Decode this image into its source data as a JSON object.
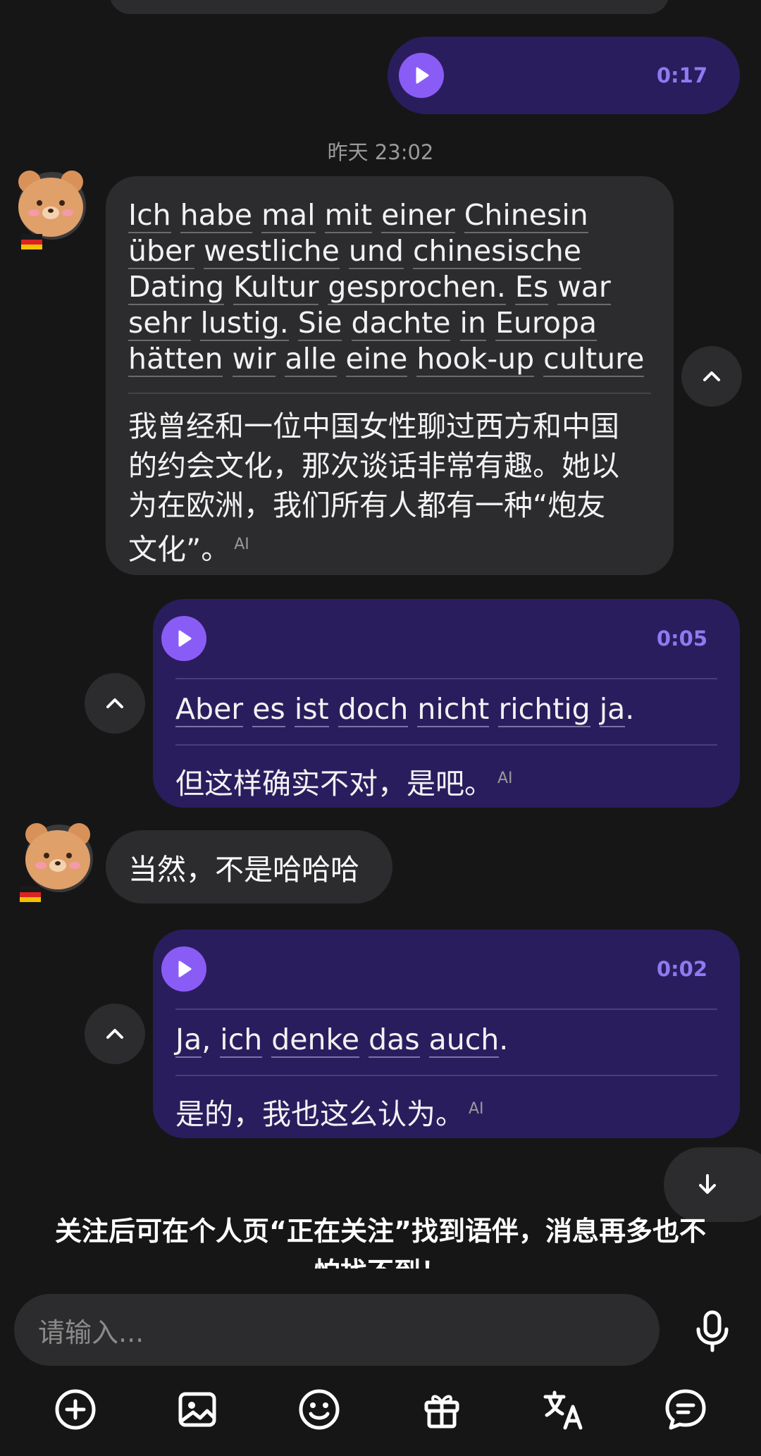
{
  "messages": {
    "voice_top": {
      "duration": "0:17"
    },
    "timestamp": "昨天 23:02",
    "msg1": {
      "de_words": [
        "Ich",
        "habe",
        "mal",
        "mit",
        "einer",
        "Chinesin",
        "über",
        "westliche",
        "und",
        "chinesische",
        "Dating",
        "Kultur",
        "gesprochen.",
        "Es",
        "war",
        "sehr",
        "lustig.",
        "Sie",
        "dachte",
        "in",
        "Europa",
        "hätten",
        "wir",
        "alle",
        "eine",
        "hook-up",
        "culture"
      ],
      "de_lines": [
        "Ich habe mal mit einer Chinesin",
        "über westliche und chinesische",
        "Dating Kultur gesprochen. Es war",
        "sehr lustig. Sie dachte in Europa",
        "hätten wir alle eine hook-up culture"
      ],
      "zh_lines": [
        "我曾经和一位中国女性聊过西方和中国",
        "的约会文化，那次谈话非常有趣。她以",
        "为在欧洲，我们所有人都有一种“炮友",
        "文化”。"
      ],
      "ai_tag": "AI"
    },
    "voice2": {
      "duration": "0:05",
      "de": "Aber es ist doch nicht richtig ja.",
      "zh": "但这样确实不对，是吧。",
      "ai_tag": "AI"
    },
    "msg_short": "当然，不是哈哈哈",
    "voice3": {
      "duration": "0:02",
      "de": "Ja, ich denke das auch.",
      "zh": "是的，我也这么认为。",
      "ai_tag": "AI"
    }
  },
  "follow_tip": "关注后可在个人页“正在关注”找到语伴，消息再多也不怕找不到！",
  "input": {
    "placeholder": "请输入..."
  },
  "icons": {
    "toolbar": [
      "plus-circle-icon",
      "image-icon",
      "emoji-icon",
      "gift-icon",
      "translate-icon",
      "chat-bubble-icon"
    ],
    "mic": "microphone-icon"
  },
  "colors": {
    "accent": "#8a5cf6",
    "self_bubble": "#2a1d5e",
    "other_bubble": "#2c2c2e",
    "background": "#161616"
  }
}
